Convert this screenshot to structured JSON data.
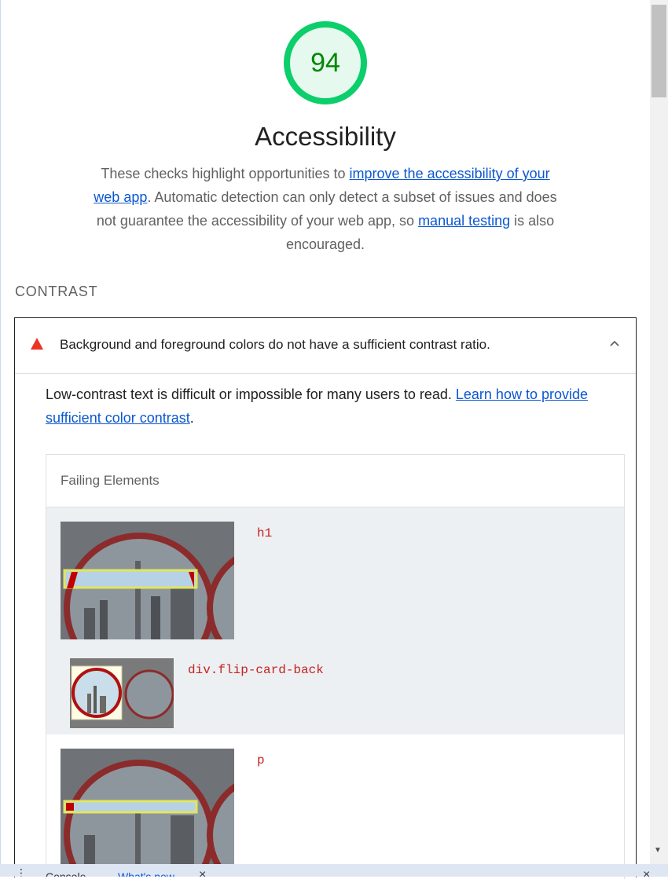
{
  "score": {
    "value": "94",
    "color": "#0cce6b"
  },
  "category": {
    "title": "Accessibility",
    "desc_1": "These checks highlight opportunities to ",
    "link_1": "improve the accessibility of your web app",
    "desc_2": ". Automatic detection can only detect a subset of issues and does not guarantee the accessibility of your web app, so ",
    "link_2": "manual testing",
    "desc_3": " is also encouraged."
  },
  "group": {
    "title": "CONTRAST"
  },
  "audit": {
    "title": "Background and foreground colors do not have a sufficient contrast ratio.",
    "icon": "warning-triangle-icon",
    "expanded_icon": "chevron-up-icon",
    "detail_1": "Low-contrast text is difficult or impossible for many users to read. ",
    "detail_link": "Learn how to provide sufficient color contrast",
    "detail_2": ".",
    "table_header": "Failing Elements",
    "items": [
      {
        "selector": "h1"
      },
      {
        "selector": "div.flip-card-back"
      },
      {
        "selector": "p"
      }
    ]
  },
  "drawer": {
    "tab_1": "Console",
    "tab_2": "What's new",
    "close_1": "×",
    "close_2": "×",
    "menu": "⋮"
  },
  "colors": {
    "link": "#0b57d0",
    "warn": "#eb3323",
    "code": "#c5221f",
    "pass": "#008800"
  }
}
